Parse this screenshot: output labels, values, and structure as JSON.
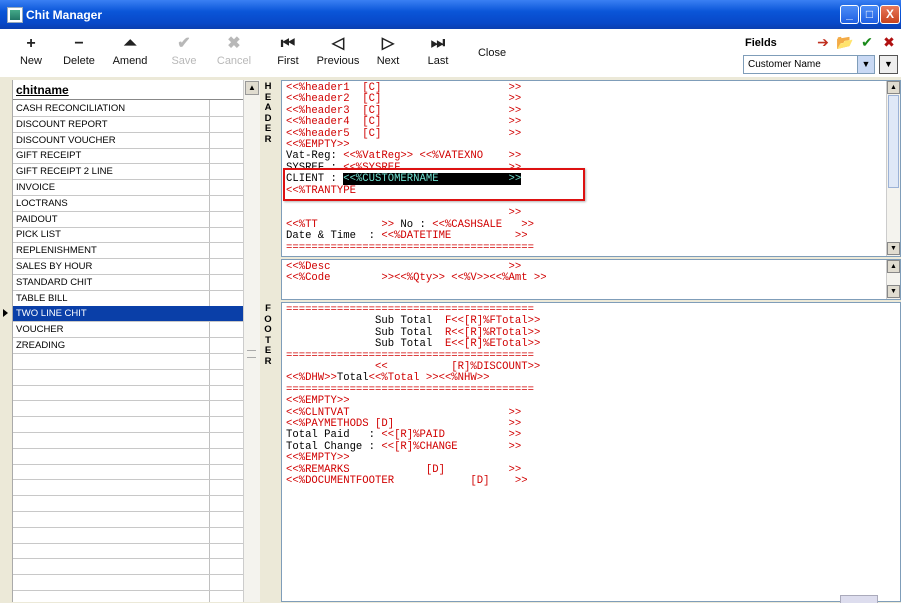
{
  "window": {
    "title": "Chit Manager",
    "min": "_",
    "max": "□",
    "close": "X"
  },
  "toolbar": [
    {
      "id": "new",
      "label": "New",
      "icon": "+",
      "enabled": true
    },
    {
      "id": "delete",
      "label": "Delete",
      "icon": "−",
      "enabled": true
    },
    {
      "id": "amend",
      "label": "Amend",
      "icon": "⏶",
      "enabled": true
    },
    {
      "id": "save",
      "label": "Save",
      "icon": "✔",
      "enabled": false
    },
    {
      "id": "cancel",
      "label": "Cancel",
      "icon": "✖",
      "enabled": false
    },
    {
      "id": "first",
      "label": "First",
      "icon": "⏮",
      "enabled": true
    },
    {
      "id": "previous",
      "label": "Previous",
      "icon": "◁",
      "enabled": true
    },
    {
      "id": "next",
      "label": "Next",
      "icon": "▷",
      "enabled": true
    },
    {
      "id": "last",
      "label": "Last",
      "icon": "⏭",
      "enabled": true
    },
    {
      "id": "close",
      "label": "Close",
      "icon": "",
      "enabled": true
    }
  ],
  "fields": {
    "label": "Fields",
    "selected": "Customer Name",
    "icons": {
      "export": "➔",
      "open": "📂",
      "accept": "✔",
      "reject": "✖"
    },
    "accept_color": "#1a8a1a",
    "reject_color": "#b01010"
  },
  "grid": {
    "header": "chitname",
    "rows": [
      "CASH RECONCILIATION",
      "DISCOUNT REPORT",
      "DISCOUNT VOUCHER",
      "GIFT RECEIPT",
      "GIFT RECEIPT 2 LINE",
      "INVOICE",
      "LOCTRANS",
      "PAIDOUT",
      "PICK LIST",
      "REPLENISHMENT",
      "SALES BY HOUR",
      "STANDARD CHIT",
      "TABLE BILL",
      "TWO LINE CHIT",
      "VOUCHER",
      "ZREADING"
    ],
    "selected_index": 13,
    "selected_color": "#0a3fa8"
  },
  "labels": {
    "header": "H\nE\nA\nD\nE\nR",
    "footer": "F\nO\nO\nT\nE\nR"
  },
  "editors": {
    "header": [
      "<<%header1  [C]                    >>",
      "<<%header2  [C]                    >>",
      "<<%header3  [C]                    >>",
      "<<%header4  [C]                    >>",
      "<<%header5  [C]                    >>",
      "<<%EMPTY>>",
      "Vat-Reg: <<%VatReg>> <<%VATEXNO    >>",
      "SYSREF : <<%SYSREF                 >>",
      "CLIENT : <<%CUSTOMERNAME           >>",
      "<<%TRANTYPE",
      "",
      "                                   >>",
      "<<%TT          >> No : <<%CASHSALE   >>",
      "Date & Time  : <<%DATETIME          >>",
      "======================================="
    ],
    "body": [
      "<<%Desc                            >>",
      "<<%Code        >><<%Qty>> <<%V>><<%Amt >>"
    ],
    "footer": [
      "=======================================",
      "              Sub Total  F<<[R]%FTotal>>",
      "              Sub Total  R<<[R]%RTotal>>",
      "              Sub Total  E<<[R]%ETotal>>",
      "=======================================",
      "              <<          [R]%DISCOUNT>>",
      "<<%DHW>>Total<<%Total >><<%NHW>>",
      "=======================================",
      "<<%EMPTY>>",
      "<<%CLNTVAT                         >>",
      "<<%PAYMETHODS [D]                  >>",
      "Total Paid   : <<[R]%PAID          >>",
      "Total Change : <<[R]%CHANGE        >>",
      "<<%EMPTY>>",
      "<<%REMARKS            [D]          >>",
      "<<%DOCUMENTFOOTER            [D]    >>"
    ]
  },
  "colors": {
    "template_text": "#d00000",
    "titlebar": "#0a55d8",
    "highlight_box": "#d11111"
  }
}
